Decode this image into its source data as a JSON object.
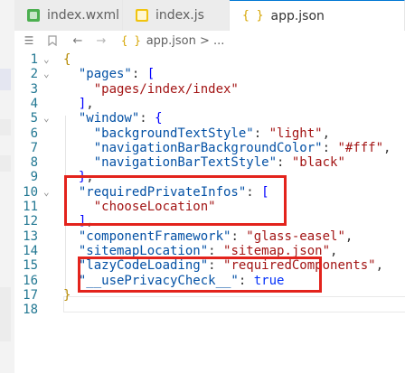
{
  "tabs": [
    {
      "label": "index.wxml",
      "icon": "wxml-file-icon"
    },
    {
      "label": "index.js",
      "icon": "js-file-icon"
    },
    {
      "label": "app.json",
      "icon": "json-file-icon",
      "active": true
    }
  ],
  "breadcrumb": {
    "json_icon_glyph": "{ }",
    "path": "app.json > ..."
  },
  "editor": {
    "line_numbers": [
      "1",
      "2",
      "3",
      "4",
      "5",
      "6",
      "7",
      "8",
      "9",
      "10",
      "11",
      "12",
      "13",
      "14",
      "15",
      "16",
      "17",
      "18"
    ],
    "lines": [
      {
        "indent": "",
        "tokens": [
          {
            "t": "{",
            "c": "br"
          }
        ]
      },
      {
        "indent": "  ",
        "tokens": [
          {
            "t": "\"pages\"",
            "c": "k"
          },
          {
            "t": ": ",
            "c": "p"
          },
          {
            "t": "[",
            "c": "m"
          }
        ]
      },
      {
        "indent": "    ",
        "tokens": [
          {
            "t": "\"pages/index/index\"",
            "c": "s"
          }
        ]
      },
      {
        "indent": "  ",
        "tokens": [
          {
            "t": "]",
            "c": "m"
          },
          {
            "t": ",",
            "c": "p"
          }
        ]
      },
      {
        "indent": "  ",
        "tokens": [
          {
            "t": "\"window\"",
            "c": "k"
          },
          {
            "t": ": ",
            "c": "p"
          },
          {
            "t": "{",
            "c": "m"
          }
        ]
      },
      {
        "indent": "    ",
        "tokens": [
          {
            "t": "\"backgroundTextStyle\"",
            "c": "k"
          },
          {
            "t": ": ",
            "c": "p"
          },
          {
            "t": "\"light\"",
            "c": "s"
          },
          {
            "t": ",",
            "c": "p"
          }
        ]
      },
      {
        "indent": "    ",
        "tokens": [
          {
            "t": "\"navigationBarBackgroundColor\"",
            "c": "k"
          },
          {
            "t": ": ",
            "c": "p"
          },
          {
            "t": "\"#fff\"",
            "c": "s"
          },
          {
            "t": ",",
            "c": "p"
          }
        ]
      },
      {
        "indent": "    ",
        "tokens": [
          {
            "t": "\"navigationBarTextStyle\"",
            "c": "k"
          },
          {
            "t": ": ",
            "c": "p"
          },
          {
            "t": "\"black\"",
            "c": "s"
          }
        ]
      },
      {
        "indent": "  ",
        "tokens": [
          {
            "t": "}",
            "c": "m"
          },
          {
            "t": ",",
            "c": "p"
          }
        ]
      },
      {
        "indent": "  ",
        "tokens": [
          {
            "t": "\"requiredPrivateInfos\"",
            "c": "k"
          },
          {
            "t": ": ",
            "c": "p"
          },
          {
            "t": "[",
            "c": "m"
          }
        ]
      },
      {
        "indent": "    ",
        "tokens": [
          {
            "t": "\"chooseLocation\"",
            "c": "s"
          }
        ]
      },
      {
        "indent": "  ",
        "tokens": [
          {
            "t": "]",
            "c": "m"
          },
          {
            "t": ",",
            "c": "p"
          }
        ]
      },
      {
        "indent": "  ",
        "tokens": [
          {
            "t": "\"componentFramework\"",
            "c": "k"
          },
          {
            "t": ": ",
            "c": "p"
          },
          {
            "t": "\"glass-easel\"",
            "c": "s"
          },
          {
            "t": ",",
            "c": "p"
          }
        ]
      },
      {
        "indent": "  ",
        "tokens": [
          {
            "t": "\"sitemapLocation\"",
            "c": "k"
          },
          {
            "t": ": ",
            "c": "p"
          },
          {
            "t": "\"sitemap.json\"",
            "c": "s"
          },
          {
            "t": ",",
            "c": "p"
          }
        ]
      },
      {
        "indent": "  ",
        "tokens": [
          {
            "t": "\"lazyCodeLoading\"",
            "c": "k"
          },
          {
            "t": ": ",
            "c": "p"
          },
          {
            "t": "\"requiredComponents\"",
            "c": "s"
          },
          {
            "t": ",",
            "c": "p"
          }
        ]
      },
      {
        "indent": "  ",
        "tokens": [
          {
            "t": "\"__usePrivacyCheck__\"",
            "c": "k"
          },
          {
            "t": ": ",
            "c": "p"
          },
          {
            "t": "true",
            "c": "bl"
          }
        ]
      },
      {
        "indent": "",
        "tokens": [
          {
            "t": "}",
            "c": "br"
          }
        ]
      },
      {
        "indent": "",
        "tokens": []
      }
    ],
    "foldable_lines": [
      1,
      2,
      5,
      10
    ]
  },
  "colors": {
    "key": "#0451a5",
    "string": "#a31515",
    "boolean": "#0431fa",
    "line_number": "#237893",
    "highlight_box": "#e3231c"
  }
}
